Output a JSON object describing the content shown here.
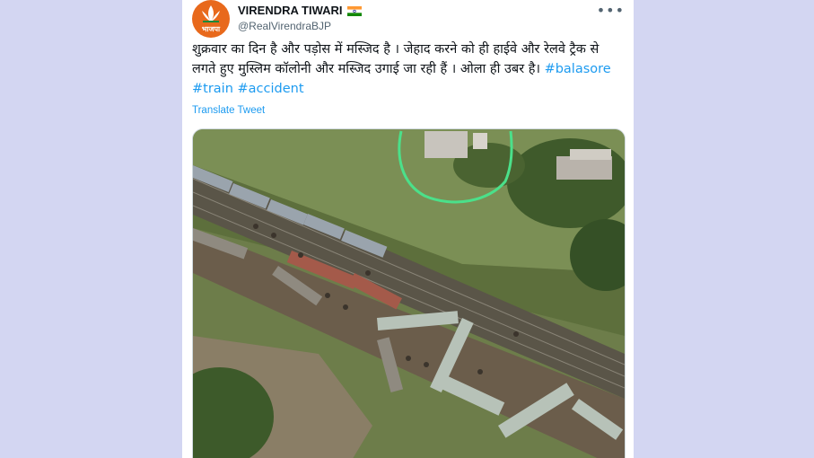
{
  "tweet": {
    "author_name": "VIRENDRA TIWARI",
    "author_handle": "@RealVirendraBJP",
    "avatar_text": "भाजपा",
    "text_parts": [
      "शुक्रवार का दिन है और पड़ोस में मस्जिद है । जेहाद करने को ही हाईवे और रेलवे ट्रैक से लगते हुए मुस्लिम कॉलोनी और मस्जिद उगाई जा रही हैं । ओला ही उबर है। "
    ],
    "hashtags": [
      "#balasore",
      "#train",
      "#accident"
    ],
    "translate_label": "Translate Tweet",
    "more_icon": "more-icon"
  },
  "colors": {
    "background": "#d3d6f2",
    "accent": "#1d9bf0",
    "avatar": "#e8691c",
    "highlight_outline": "#4be08a"
  }
}
